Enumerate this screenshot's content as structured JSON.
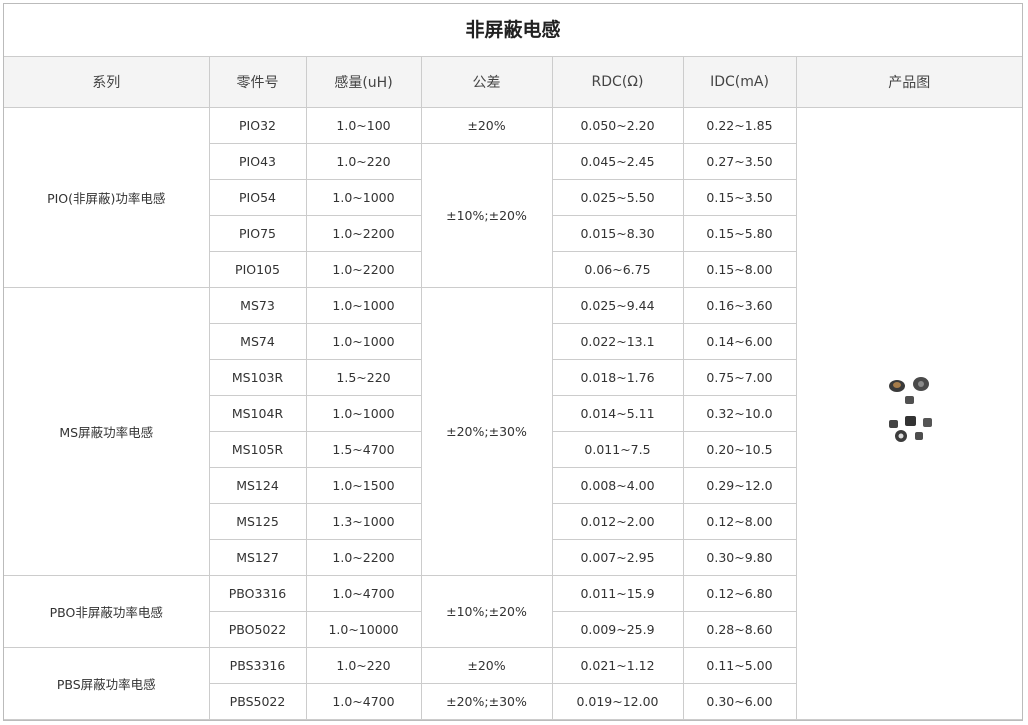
{
  "title": "非屏蔽电感",
  "headers": [
    "系列",
    "零件号",
    "感量(uH)",
    "公差",
    "RDC(Ω)",
    "IDC(mA)",
    "产品图"
  ],
  "groups": [
    {
      "series": "PIO(非屏蔽)功率电感",
      "tolerances": [
        "±20%",
        "±10%;±20%"
      ],
      "rows": [
        {
          "part": "PIO32",
          "inductance": "1.0~100",
          "rdc": "0.050~2.20",
          "idc": "0.22~1.85"
        },
        {
          "part": "PIO43",
          "inductance": "1.0~220",
          "rdc": "0.045~2.45",
          "idc": "0.27~3.50"
        },
        {
          "part": "PIO54",
          "inductance": "1.0~1000",
          "rdc": "0.025~5.50",
          "idc": "0.15~3.50"
        },
        {
          "part": "PIO75",
          "inductance": "1.0~2200",
          "rdc": "0.015~8.30",
          "idc": "0.15~5.80"
        },
        {
          "part": "PIO105",
          "inductance": "1.0~2200",
          "rdc": "0.06~6.75",
          "idc": "0.15~8.00"
        }
      ]
    },
    {
      "series": "MS屏蔽功率电感",
      "tolerances": [
        "±20%;±30%"
      ],
      "rows": [
        {
          "part": "MS73",
          "inductance": "1.0~1000",
          "rdc": "0.025~9.44",
          "idc": "0.16~3.60"
        },
        {
          "part": "MS74",
          "inductance": "1.0~1000",
          "rdc": "0.022~13.1",
          "idc": "0.14~6.00"
        },
        {
          "part": "MS103R",
          "inductance": "1.5~220",
          "rdc": "0.018~1.76",
          "idc": "0.75~7.00"
        },
        {
          "part": "MS104R",
          "inductance": "1.0~1000",
          "rdc": "0.014~5.11",
          "idc": "0.32~10.0"
        },
        {
          "part": "MS105R",
          "inductance": "1.5~4700",
          "rdc": "0.011~7.5",
          "idc": "0.20~10.5"
        },
        {
          "part": "MS124",
          "inductance": "1.0~1500",
          "rdc": "0.008~4.00",
          "idc": "0.29~12.0"
        },
        {
          "part": "MS125",
          "inductance": "1.3~1000",
          "rdc": "0.012~2.00",
          "idc": "0.12~8.00"
        },
        {
          "part": "MS127",
          "inductance": "1.0~2200",
          "rdc": "0.007~2.95",
          "idc": "0.30~9.80"
        }
      ]
    },
    {
      "series": "PBO非屏蔽功率电感",
      "tolerances": [
        "±10%;±20%"
      ],
      "rows": [
        {
          "part": "PBO3316",
          "inductance": "1.0~4700",
          "rdc": "0.011~15.9",
          "idc": "0.12~6.80"
        },
        {
          "part": "PBO5022",
          "inductance": "1.0~10000",
          "rdc": "0.009~25.9",
          "idc": "0.28~8.60"
        }
      ]
    },
    {
      "series": "PBS屏蔽功率电感",
      "tolerances": [
        "±20%",
        "±20%;±30%"
      ],
      "rows": [
        {
          "part": "PBS3316",
          "inductance": "1.0~220",
          "rdc": "0.021~1.12",
          "idc": "0.11~5.00"
        },
        {
          "part": "PBS5022",
          "inductance": "1.0~4700",
          "rdc": "0.019~12.00",
          "idc": "0.30~6.00"
        }
      ]
    }
  ]
}
